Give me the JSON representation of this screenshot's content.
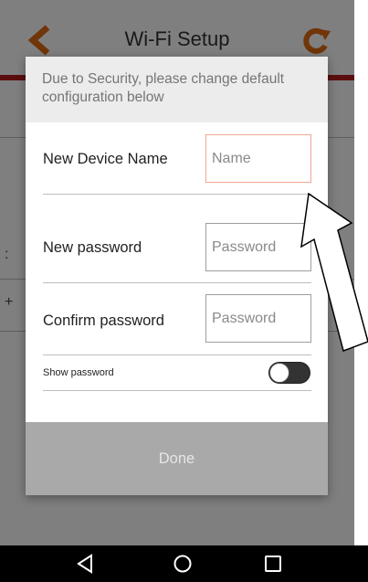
{
  "app": {
    "title": "Wi-Fi Setup",
    "accent_color": "#e06b10",
    "header_bar_color": "#b71c1c",
    "back_icon": "chevron-left-icon",
    "refresh_icon": "refresh-icon"
  },
  "background": {
    "row_glyph_1": ":",
    "row_glyph_2": "+"
  },
  "dialog": {
    "message": "Due to Security, please change default configuration below",
    "device_name_label": "New Device Name",
    "device_name_placeholder": "Name",
    "new_password_label": "New password",
    "new_password_placeholder": "Password",
    "confirm_password_label": "Confirm password",
    "confirm_password_placeholder": "Password",
    "show_password_label": "Show password",
    "show_password_on": false,
    "done_label": "Done"
  },
  "annotation": {
    "arrow_icon": "arrow-up-left-icon"
  },
  "navbar": {
    "back_icon": "nav-back-icon",
    "home_icon": "nav-home-icon",
    "recents_icon": "nav-recents-icon"
  }
}
